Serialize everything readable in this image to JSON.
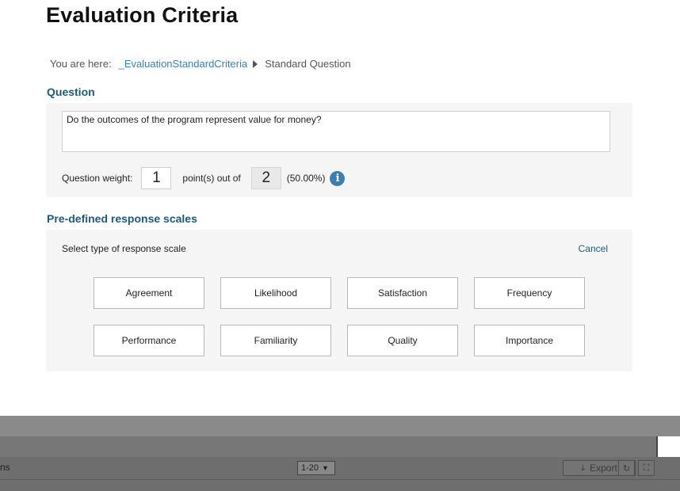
{
  "header": {
    "title": "Evaluation Criteria"
  },
  "breadcrumb": {
    "label": "You are here:",
    "link": "_EvaluationStandardCriteria",
    "current": "Standard Question"
  },
  "question_section": {
    "heading": "Question",
    "text": "Do the outcomes of the program represent value for money?",
    "weight_label": "Question weight:",
    "weight_value": "1",
    "points_label": "point(s) out of",
    "points_total": "2",
    "percentage": "(50.00%)",
    "info_icon": "info-icon"
  },
  "scales_section": {
    "heading": "Pre-defined response scales",
    "select_label": "Select type of response scale",
    "cancel_label": "Cancel",
    "options": [
      "Agreement",
      "Likelihood",
      "Satisfaction",
      "Frequency",
      "Performance",
      "Familiarity",
      "Quality",
      "Importance"
    ]
  },
  "footer": {
    "fragment": "ns",
    "pager_value": "1-20",
    "export_label": "Export",
    "export_icon": "download-icon",
    "refresh_icon": "refresh-icon",
    "fullscreen_icon": "fullscreen-icon"
  },
  "colors": {
    "accent": "#1d5a77",
    "link": "#3b7fb0",
    "panel": "#f5f5f5"
  }
}
